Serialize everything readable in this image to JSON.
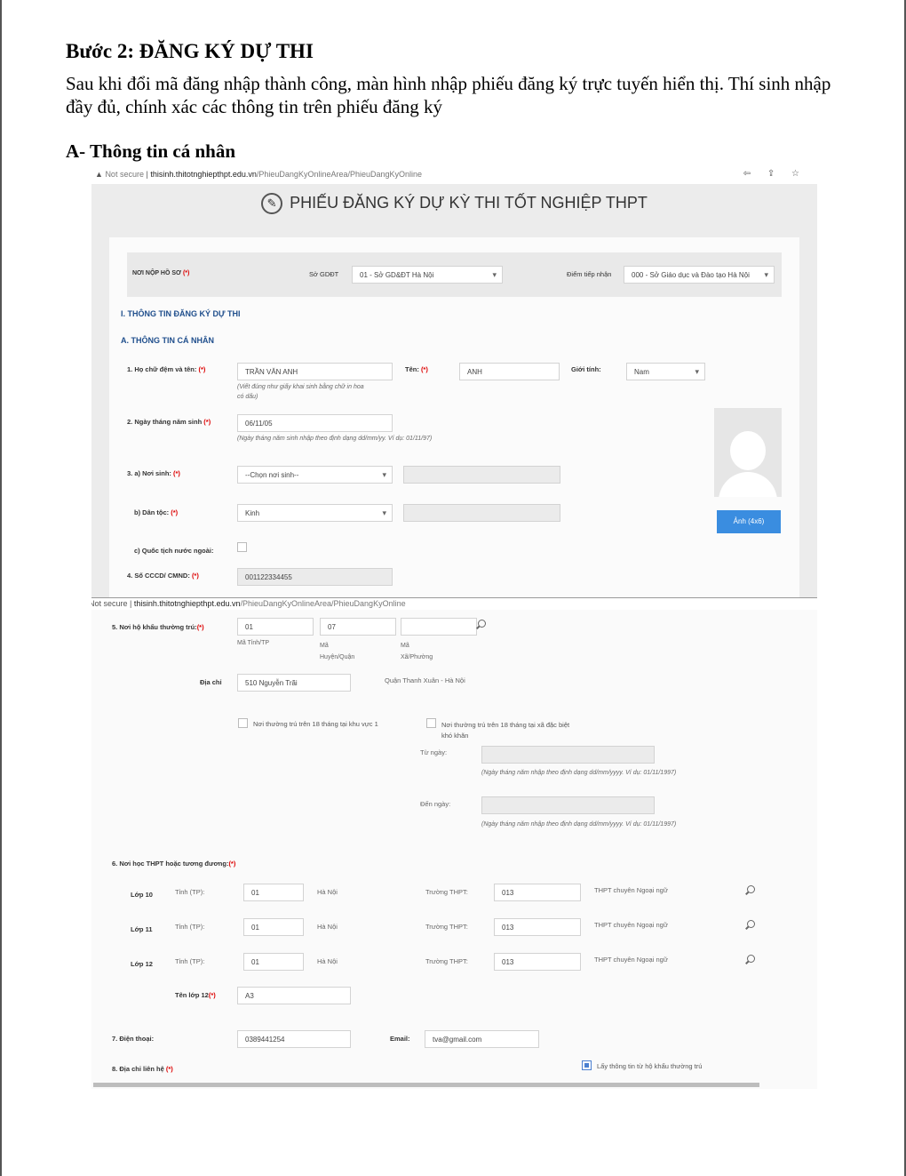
{
  "document": {
    "heading": "Bước 2: ĐĂNG KÝ DỰ THI",
    "paragraph": "Sau khi đổi mã đăng nhập thành công, màn hình nhập phiếu đăng ký trực tuyến hiển thị. Thí sinh nhập đầy đủ, chính xác các thông tin trên phiếu đăng ký",
    "subheading": "A- Thông tin cá nhân"
  },
  "browser": {
    "security": "Not secure",
    "host": "thisinh.thitotnghiepthpt.edu.vn",
    "path": "/PhieuDangKyOnlineArea/PhieuDangKyOnline",
    "security_cut": "Not secure",
    "tools": "⇦ ⇪ ☆"
  },
  "form": {
    "title": "PHIẾU ĐĂNG KÝ DỰ KỲ THI TỐT NGHIỆP THPT",
    "pen_icon": "✎",
    "required_mark": "(*)",
    "submit_place": {
      "label": "NƠI NỘP HỒ SƠ",
      "so_label": "Sở GDĐT",
      "so_value": "01 - Sở GD&ĐT Hà Nội",
      "diem_label": "Điểm tiếp nhận",
      "diem_value": "000 - Sở Giáo dục và Đào tạo Hà Nội"
    },
    "section1_title": "I. THÔNG TIN ĐĂNG KÝ DỰ THI",
    "sectionA_title": "A. THÔNG TIN CÁ NHÂN",
    "fullname": {
      "label": "1. Họ chữ đệm và tên:",
      "value": "TRẦN VĂN ANH",
      "hint_line1": "(Viết đúng như giấy khai sinh bằng chữ in hoa",
      "hint_line2": "có dấu)"
    },
    "ten": {
      "label": "Tên:",
      "value": "ANH"
    },
    "gender": {
      "label": "Giới tính:",
      "value": "Nam"
    },
    "dob": {
      "label": "2. Ngày tháng năm sinh",
      "value": "06/11/05",
      "hint": "(Ngày tháng năm sinh nhập theo định dạng dd/mm/yy. Ví dụ: 01/11/97)"
    },
    "birthplace": {
      "label": "3. a) Nơi sinh:",
      "value": "--Chọn nơi sinh--"
    },
    "ethnic": {
      "label": "b) Dân tộc:",
      "value": "Kinh"
    },
    "foreign": {
      "label": "c) Quốc tịch nước ngoài:"
    },
    "cccd": {
      "label": "4. Số CCCD/ CMND:",
      "value": "001122334455"
    },
    "photo_button": "Ảnh (4x6)",
    "residence": {
      "label": "5. Nơi hộ khẩu thường trú:",
      "tinh": "01",
      "tinh_label": "Mã Tỉnh/TP",
      "huyen": "07",
      "huyen_label1": "Mã",
      "huyen_label2": "Huyện/Quận",
      "xa": "",
      "xa_label1": "Mã",
      "xa_label2": "Xã/Phường",
      "address_label": "Địa chỉ",
      "address_value": "510 Nguyễn Trãi",
      "district_text": "Quận Thanh Xuân - Hà Nội",
      "kv1_label": "Nơi thường trú trên 18 tháng tại khu vực 1",
      "xadb_label1": "Nơi thường trú trên 18 tháng tại xã đặc biệt",
      "xadb_label2": "khó khăn",
      "from_label": "Từ ngày:",
      "to_label": "Đến ngày:",
      "date_hint": "(Ngày tháng năm nhập theo định dạng dd/mm/yyyy. Ví dụ: 01/11/1997)"
    },
    "school": {
      "label": "6. Nơi học THPT hoặc tương đương:",
      "tinh_label": "Tỉnh (TP):",
      "truong_label": "Trường THPT:",
      "rows": [
        {
          "lop": "Lớp 10",
          "tinh": "01",
          "tinh_name": "Hà Nội",
          "truong": "013",
          "truong_name": "THPT chuyên Ngoại ngữ"
        },
        {
          "lop": "Lớp 11",
          "tinh": "01",
          "tinh_name": "Hà Nội",
          "truong": "013",
          "truong_name": "THPT chuyên Ngoại ngữ"
        },
        {
          "lop": "Lớp 12",
          "tinh": "01",
          "tinh_name": "Hà Nội",
          "truong": "013",
          "truong_name": "THPT chuyên Ngoại ngữ"
        }
      ],
      "class12_label": "Tên lớp 12",
      "class12_value": "A3"
    },
    "phone": {
      "label": "7. Điện thoại:",
      "value": "0389441254"
    },
    "email": {
      "label": "Email:",
      "value": "tva@gmail.com"
    },
    "contact": {
      "label": "8. Địa chỉ liên hệ",
      "copy_label": "Lấy thông tin từ hộ khẩu thường trú"
    }
  }
}
